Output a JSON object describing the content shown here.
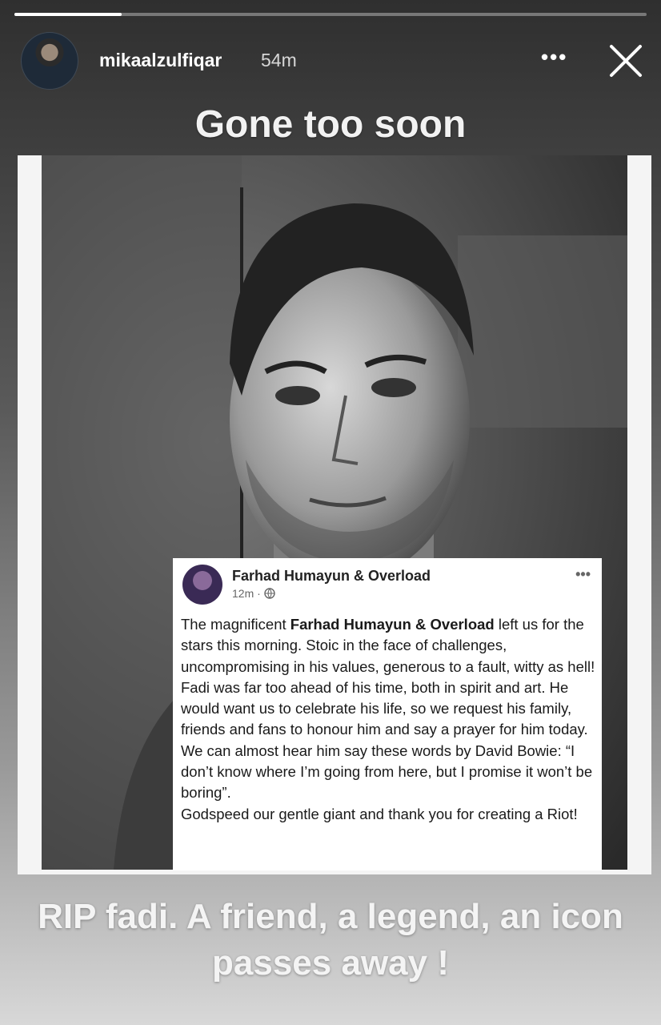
{
  "story": {
    "progress": 0.17,
    "username": "mikaalzulfiqar",
    "time_ago": "54m",
    "more_icon": "more-horizontal-icon",
    "close_icon": "close-icon"
  },
  "captions": {
    "top": "Gone too soon",
    "bottom": "RIP fadi. A friend, a legend, an icon passes away !"
  },
  "post_card": {
    "name": "Farhad Humayun & Overload",
    "time": "12m",
    "privacy_icon": "globe-icon",
    "body_intro": "The magnificent ",
    "body_bold": "Farhad Humayun & Overload",
    "body_rest": " left us for the stars this morning. Stoic in the face of challenges, uncompromising in his values, generous to a fault, witty as hell! Fadi was far too ahead of his time, both in spirit and art. He would want us to celebrate his life, so we request his family, friends and fans to honour him and say a prayer for him today.",
    "body_quote": "We can almost hear him say these words by David Bowie: “I don’t know where I’m going from here, but I promise it won’t be boring”.",
    "body_end": "Godspeed our gentle giant and thank you for creating a Riot!"
  }
}
